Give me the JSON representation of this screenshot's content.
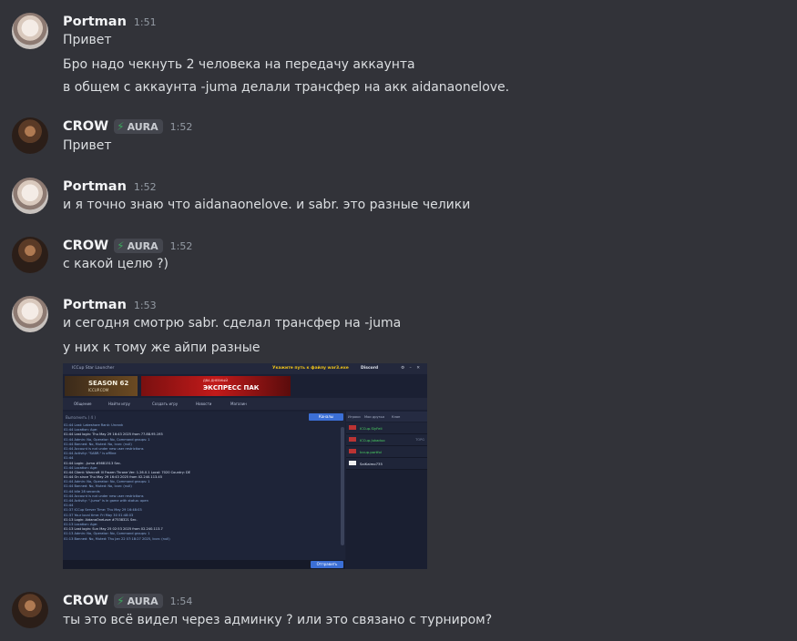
{
  "messages": [
    {
      "author": "Portman",
      "time": "1:51",
      "avatar": "portman-avatar",
      "lines": [
        "Привет",
        "Бро надо чекнуть 2 человека на передачу аккаунта",
        "в общем с аккаунта -juma делали трансфер на акк aidanaonelove."
      ]
    },
    {
      "author": "CROW",
      "tag": "AURA",
      "time": "1:52",
      "avatar": "crow-avatar",
      "lines": [
        "Привет"
      ]
    },
    {
      "author": "Portman",
      "time": "1:52",
      "avatar": "portman-avatar",
      "lines": [
        "и я точно знаю что aidanaonelove. и sabr. это разные челики"
      ]
    },
    {
      "author": "CROW",
      "tag": "AURA",
      "time": "1:52",
      "avatar": "crow-avatar",
      "lines": [
        "с какой целю ?)"
      ]
    },
    {
      "author": "Portman",
      "time": "1:53",
      "avatar": "portman-avatar",
      "lines": [
        "и сегодня смотрю sabr. сделал трансфер на -juma",
        "у них к тому же айпи разные"
      ]
    },
    {
      "author": "CROW",
      "tag": "AURA",
      "time": "1:54",
      "avatar": "crow-avatar",
      "lines": [
        "ты это всё видел через админку ? или это связано с турниром?"
      ]
    }
  ],
  "attachment": {
    "app_title": "ICCup Star Launcher",
    "notice": "Укажите путь к файлу war3.exe",
    "discord_label": "Discord",
    "banner_season": "SEASON 62",
    "banner_season_sub": "ICCUP.COM",
    "banner_express": "ЭКСПРЕСС ПАК",
    "banner_express_sub": "ДВА ДНЕВНЫЙ",
    "tabs": [
      "Общение",
      "Найти игру",
      "Создать игру",
      "Новости",
      "Магазин"
    ],
    "chat_header": "Выполнить ( 4 )",
    "channels_button": "Каналы",
    "send_button": "Отправить",
    "player_tabs": [
      "Игроки",
      "Мои друзья",
      "Клан"
    ],
    "players": [
      {
        "name": "ICCup.SlyFeli",
        "rank": ""
      },
      {
        "name": "ICCup.Jukaduo",
        "rank": "TOPG"
      },
      {
        "name": "Iccup.portfol",
        "rank": ""
      },
      {
        "name": "SaiKaimo735",
        "rank": ""
      }
    ],
    "log_lines": [
      "01:44 Last: Lakeshore                      Rank: Unrank",
      "01:44 Location:                    Age:",
      "01:44 Last login: Thu May 29 16:43 2025 from 77.88.95.193",
      "01:44 Admin: No, Operator: No, Command groups: 1",
      "01:44 Banned: No, Muted: No, Icon: (null)",
      "01:44 Account is not under new user restrictions",
      "01:44 Activity: \"SABR.\" is offline",
      "01:44",
      "01:44 Login: -Juma             #5681513 Sec.",
      "01:44 Location:                    Age:",
      "01:44 Client: Warcraft III Frozen Throne   Ver: 1.26.0.1  Local: 7020  Country: DE",
      "01:44 On since Thu May 29 16:43 2025 from 02.240.113.45",
      "01:44 Admin: No, Operator: No, Command groups: 1",
      "01:44 Banned: No, Muted: No, Icon: (null)",
      "01:44 Idle 28 seconds",
      "01:44 Account is not under new user restrictions",
      "01:44 Activity: \"-Juma\" is in game with status: open",
      "01:44",
      "01:37 ICCup Server Time: Thu May 29 16:48:03",
      "01:37 Your local time: Fri May 30 01:48:03",
      "01:13 Login: AidanaOneLove      #7538321 Sec.",
      "01:13 Location:                    Age:",
      "01:13 Last login: Sun May 25 02:53 2025 from 02.240.113.7",
      "01:13 Admin: No, Operator: No, Command groups: 1",
      "01:13 Banned: No, Muted: Thu Jan 22 07:18:27 2025, Icon: (null)"
    ]
  }
}
